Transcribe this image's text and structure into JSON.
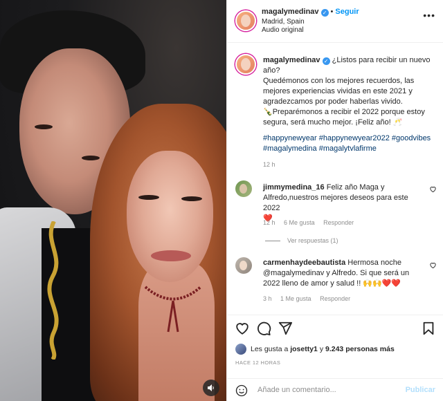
{
  "post": {
    "username": "magalymedinav",
    "follow_label": "Seguir",
    "location": "Madrid, Spain",
    "audio": "Audio original"
  },
  "caption": {
    "username": "magalymedinav",
    "line1": "¿Listos para recibir un nuevo año?",
    "line2": "Quedémonos con los mejores recuerdos, las mejores experiencias vividas en este 2021 y agradezcamos por poder haberlas vivido.",
    "line3": "Preparémonos a recibir el 2022 porque estoy segura, será mucho mejor. ¡Feliz año! 🥂",
    "line3_emoji": "🍾",
    "hashtags1": "#happynewyear #happynewyear2022 #goodvibes",
    "hashtags2": "#magalymedina #magalytvlafirme",
    "time": "12 h"
  },
  "comments": [
    {
      "username": "jimmymedina_16",
      "text": "Feliz año Maga y Alfredo,nuestros mejores deseos para este 2022",
      "heart": "❤️",
      "time": "12 h",
      "likes": "6 Me gusta",
      "reply": "Responder",
      "view_replies": "Ver respuestas (1)"
    },
    {
      "username": "carmenhaydeebautista",
      "text": "Hermosa noche @magalymedinav y Alfredo. Si que será un 2022 lleno de amor y salud !! 🙌🙌❤️❤️",
      "time": "3 h",
      "likes": "1 Me gusta",
      "reply": "Responder"
    }
  ],
  "likes_summary": {
    "prefix": "Les gusta a",
    "user": "josetty1",
    "middle": "y",
    "count": "9.243 personas más"
  },
  "posted": "HACE 12 HORAS",
  "comment_box": {
    "placeholder": "Añade un comentario...",
    "publish": "Publicar"
  },
  "icons": {
    "like": "heart-icon",
    "comment": "comment-icon",
    "share": "share-icon",
    "save": "bookmark-icon",
    "emoji": "emoji-icon",
    "audio": "speaker-icon",
    "more": "more-icon"
  },
  "colors": {
    "accent": "#0095f6",
    "hashtag": "#00376b",
    "muted": "#8e8e8e",
    "verified": "#3897f0"
  }
}
